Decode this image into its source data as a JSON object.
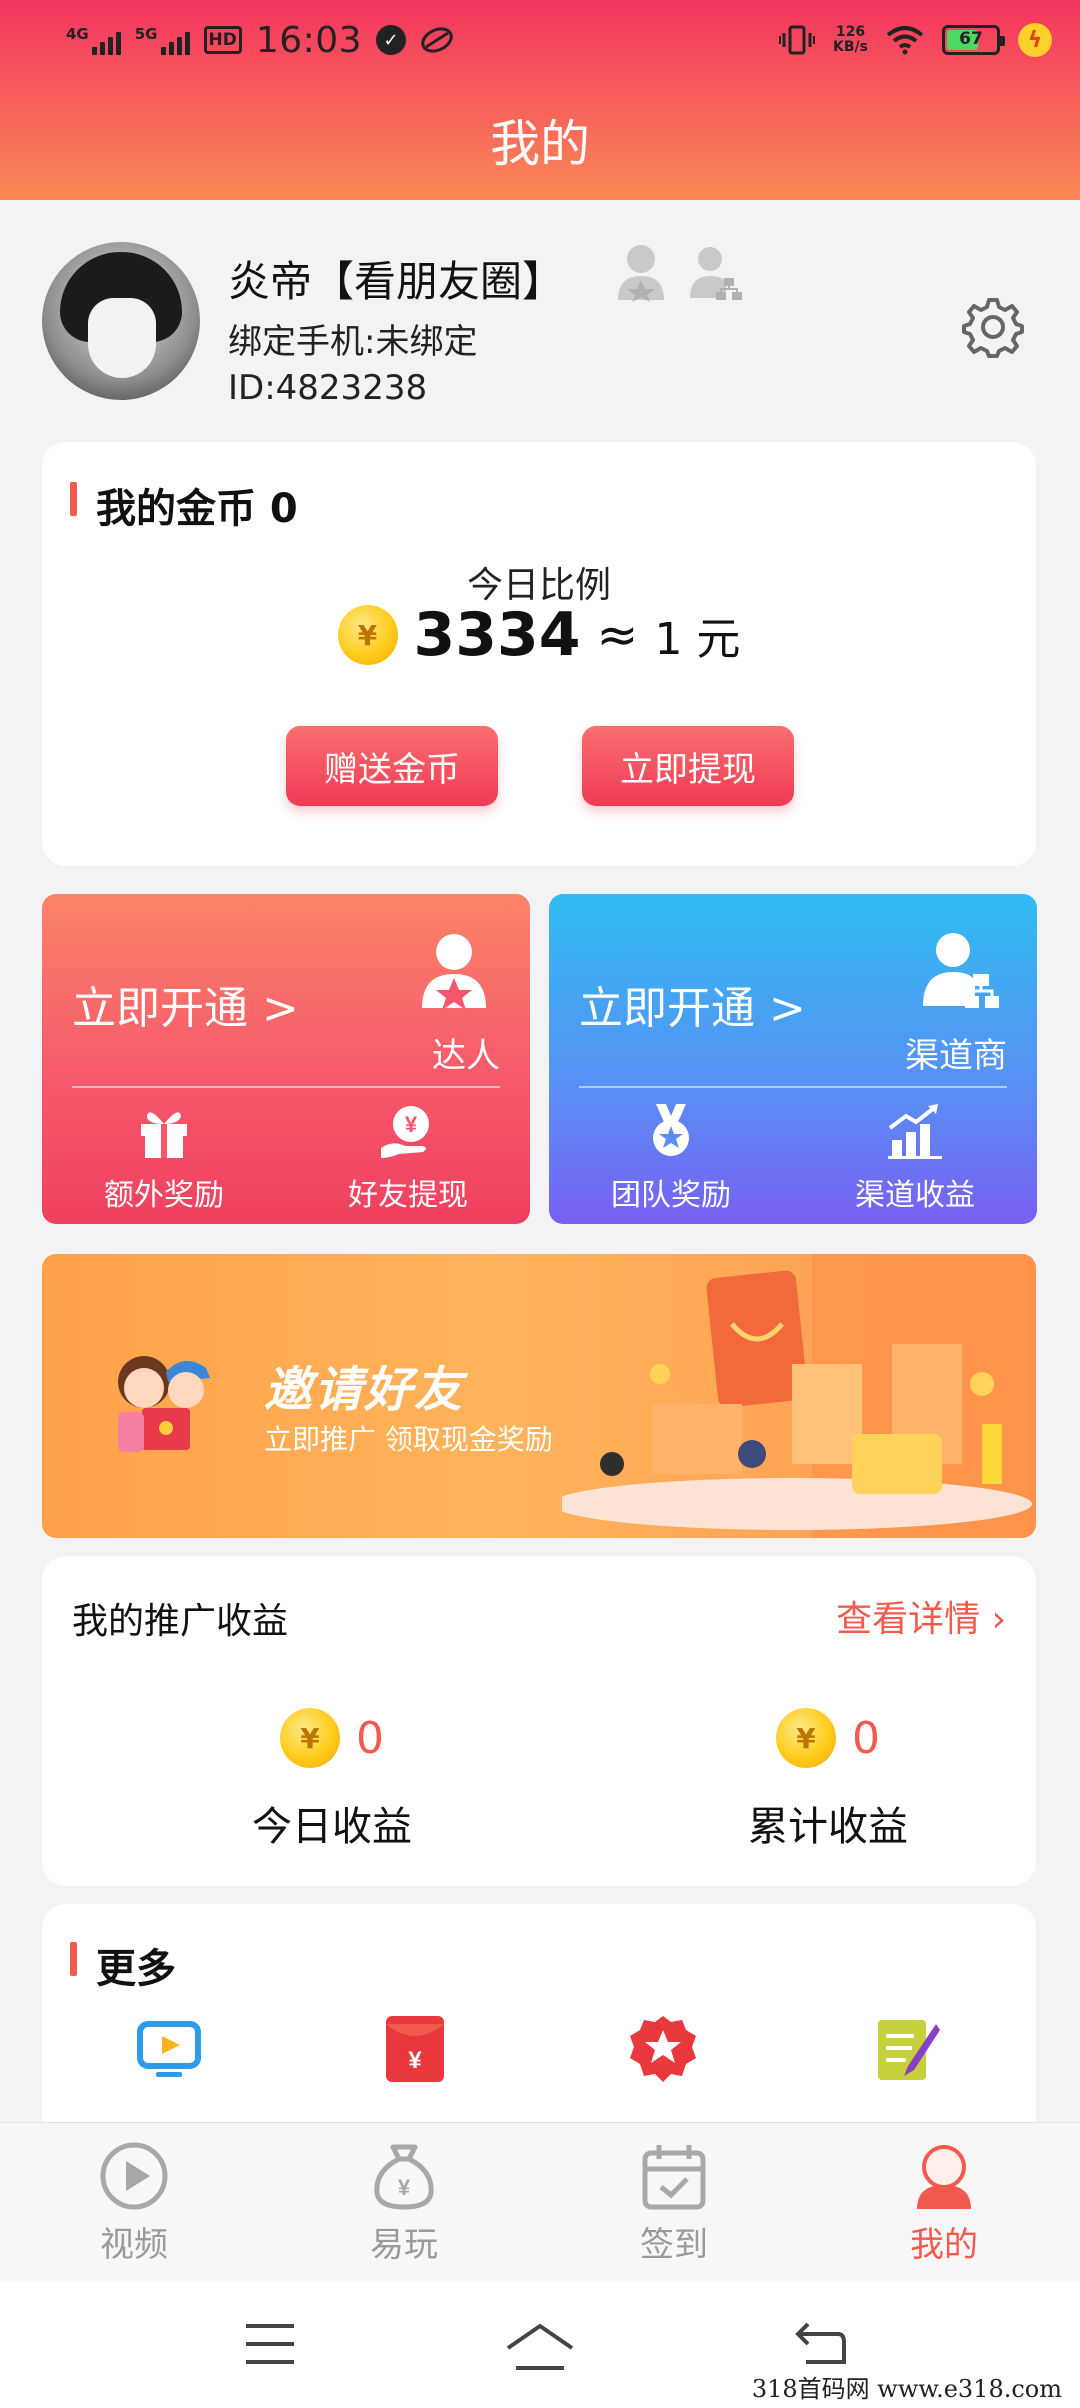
{
  "status_bar": {
    "sim1": "4G",
    "sim2": "5G",
    "hd": "HD",
    "time": "16:03",
    "net_speed_value": "126",
    "net_speed_unit": "KB/s",
    "battery": "67",
    "battery_level": 0.67
  },
  "header": {
    "title": "我的"
  },
  "profile": {
    "name": "炎帝【看朋友圈】",
    "phone": "绑定手机:未绑定",
    "id": "ID:4823238"
  },
  "coins": {
    "title": "我的金币 0",
    "ratio_label": "今日比例",
    "coin_symbol": "¥",
    "ratio_value": "3334",
    "approx": "≈",
    "ratio_unit": "1 元",
    "gift_button": "赠送金币",
    "withdraw_button": "立即提现"
  },
  "vip_cards": [
    {
      "open_label": "立即开通 >",
      "badge_label": "达人",
      "items": [
        {
          "label": "额外奖励"
        },
        {
          "label": "好友提现",
          "symbol": "¥"
        }
      ]
    },
    {
      "open_label": "立即开通 >",
      "badge_label": "渠道商",
      "items": [
        {
          "label": "团队奖励"
        },
        {
          "label": "渠道收益"
        }
      ]
    }
  ],
  "banner": {
    "title": "邀请好友",
    "subtitle": "立即推广 领取现金奖励"
  },
  "earnings": {
    "title": "我的推广收益",
    "details_link": "查看详情",
    "today_value": "0",
    "today_label": "今日收益",
    "total_value": "0",
    "total_label": "累计收益"
  },
  "more": {
    "title": "更多"
  },
  "tabs": [
    {
      "label": "视频",
      "icon": "play-icon"
    },
    {
      "label": "易玩",
      "icon": "money-bag-icon"
    },
    {
      "label": "签到",
      "icon": "calendar-icon"
    },
    {
      "label": "我的",
      "icon": "profile-icon"
    }
  ],
  "watermark": "318首码网 www.e318.com",
  "colors": {
    "accent": "#f25a4e",
    "header_top": "#f4345f",
    "header_bottom": "#fb8a55",
    "vip_red": "#f5566b",
    "vip_blue": "#5a8ef4",
    "banner": "#ffa24a"
  }
}
